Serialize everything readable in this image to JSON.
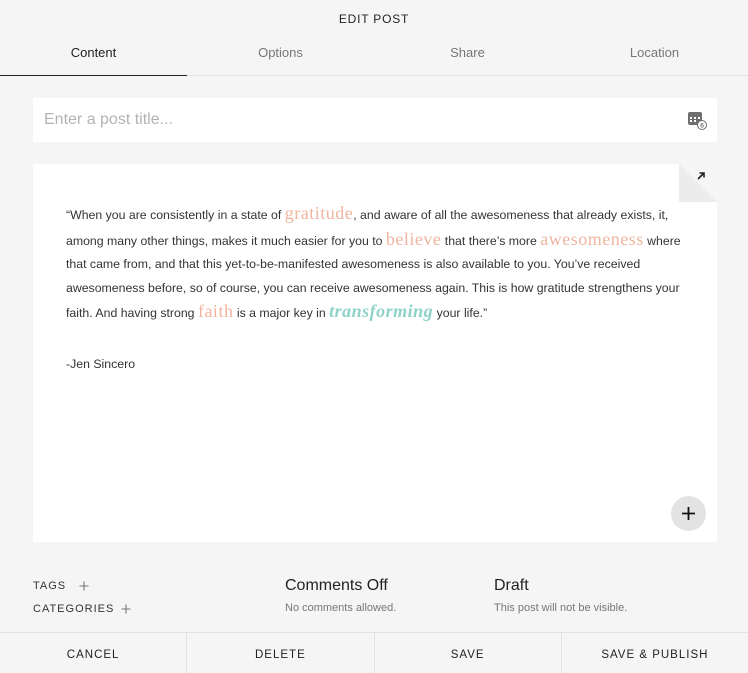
{
  "header": {
    "title": "EDIT POST"
  },
  "tabs": [
    {
      "label": "Content",
      "active": true
    },
    {
      "label": "Options"
    },
    {
      "label": "Share"
    },
    {
      "label": "Location"
    }
  ],
  "post": {
    "title_value": "",
    "title_placeholder": "Enter a post title...",
    "calendar_badge": "6"
  },
  "body": {
    "q1": "“When you are consistently in a state of ",
    "w_gratitude": "gratitude",
    "q2": ", and aware of all the awesomeness that already exists, it, among many other things, makes it much easier for you to ",
    "w_believe": "believe",
    "q3": " that there’s more ",
    "w_awesomeness": "awesomeness",
    "q4": " where that came from, and that this yet-to-be-manifested awesomeness is also available to you. You’ve received awesomeness before, so of course, you can receive awesomeness again. This is how gratitude strengthens your faith. And having strong ",
    "w_faith": "faith",
    "q5": " is a major key in ",
    "w_transforming": "transforming",
    "q6": " your life.”",
    "author": "-Jen Sincero"
  },
  "meta": {
    "tags_label": "TAGS",
    "categories_label": "CATEGORIES",
    "comments_title": "Comments Off",
    "comments_sub": "No comments allowed.",
    "status_title": "Draft",
    "status_sub": "This post will not be visible."
  },
  "footer": {
    "cancel": "CANCEL",
    "delete": "DELETE",
    "save": "SAVE",
    "save_publish": "SAVE & PUBLISH"
  },
  "colors": {
    "highlight_peach": "#f1b49e",
    "highlight_teal": "#8ed2c8",
    "background": "#f5f5f5"
  },
  "icons": {
    "calendar": "calendar-icon",
    "expand": "expand-arrow-icon",
    "add_block": "plus-icon",
    "add_tag": "plus-icon",
    "add_category": "plus-icon"
  }
}
